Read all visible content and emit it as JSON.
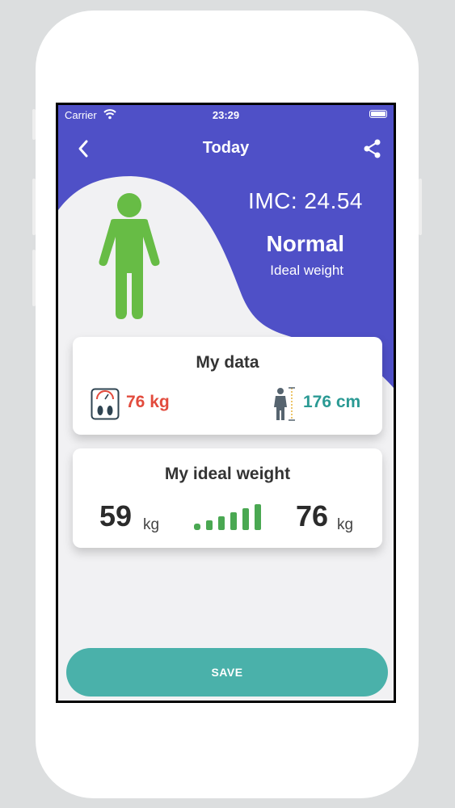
{
  "colors": {
    "header": "#4f50c7",
    "accent_green": "#67bc45",
    "weight_red": "#e24b3d",
    "height_teal": "#2b9a94",
    "save_teal": "#4ab1aa"
  },
  "status_bar": {
    "carrier": "Carrier",
    "time": "23:29"
  },
  "nav": {
    "title": "Today",
    "back_icon": "chevron-left-icon",
    "share_icon": "share-icon"
  },
  "result": {
    "imc": "IMC: 24.54",
    "status": "Normal",
    "subtitle": "Ideal weight"
  },
  "my_data": {
    "title": "My data",
    "weight": "76 kg",
    "height": "176 cm"
  },
  "ideal_weight": {
    "title": "My ideal weight",
    "min_value": "59",
    "min_unit": "kg",
    "max_value": "76",
    "max_unit": "kg"
  },
  "save_button": {
    "label": "SAVE"
  }
}
